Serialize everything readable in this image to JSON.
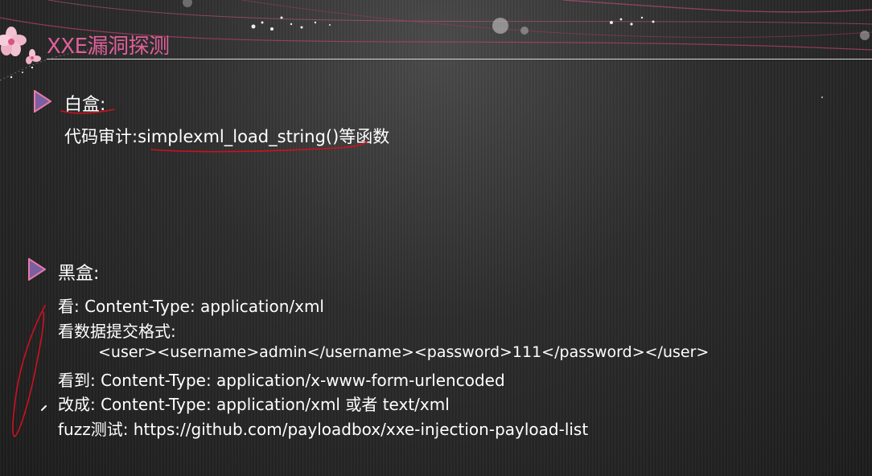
{
  "slide": {
    "title": "XXE漏洞探测",
    "white_box": {
      "heading": "白盒:",
      "code_audit_label": "代码审计:",
      "code_audit_value": "simplexml_load_string()等函数"
    },
    "black_box": {
      "heading": "黑盒:",
      "lines": [
        "看: Content-Type: application/xml",
        "看数据提交格式:",
        "<user><username>admin</username><password>111</password></user>",
        "看到: Content-Type: application/x-www-form-urlencoded",
        "改成: Content-Type: application/xml 或者 text/xml",
        "fuzz测试: https://github.com/payloadbox/xxe-injection-payload-list"
      ]
    }
  },
  "colors": {
    "title": "#e0609a",
    "bullet_fill": "#7b5fa0",
    "bullet_accent": "#e87aa8",
    "annotation_ink": "#d01020",
    "text": "#ffffff"
  },
  "icons": {
    "bullet": "triangle-bullet-icon",
    "decoration": "cherry-blossom-icon"
  }
}
